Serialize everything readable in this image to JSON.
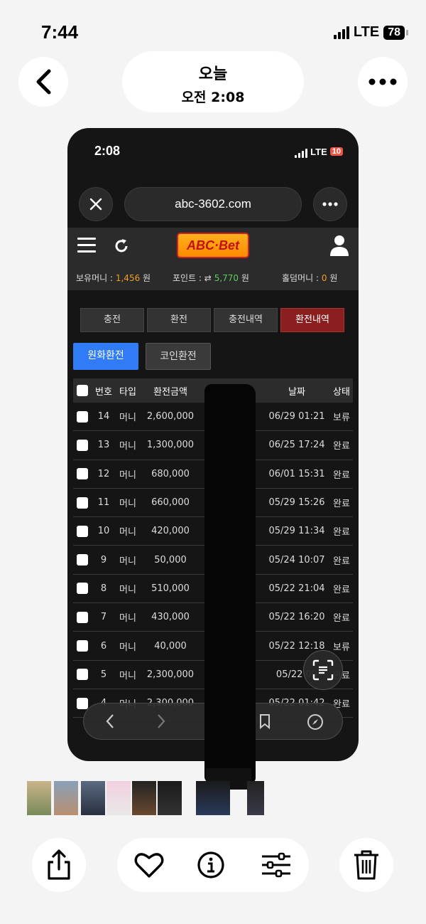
{
  "status_bar": {
    "time": "7:44",
    "network": "LTE",
    "battery": "78"
  },
  "header": {
    "date_label": "오늘",
    "time_label": "오전 2:08"
  },
  "phone": {
    "status": {
      "time": "2:08",
      "network": "LTE",
      "battery": "10"
    },
    "url": "abc-3602.com",
    "logo_text": "ABC·Bet",
    "balances": {
      "money_label": "보유머니 :",
      "money_value": "1,456",
      "money_unit": "원",
      "point_label": "포인트 : ⇄",
      "point_value": "5,770",
      "point_unit": "원",
      "holdem_label": "홀덤머니 :",
      "holdem_value": "0",
      "holdem_unit": "원"
    },
    "tabs": [
      "충전",
      "환전",
      "충전내역",
      "환전내역"
    ],
    "subtabs": [
      "원화환전",
      "코인환전"
    ],
    "table": {
      "headers": [
        "번호",
        "타입",
        "환전금액",
        "",
        "날짜",
        "상태"
      ],
      "rows": [
        {
          "no": "14",
          "type": "머니",
          "amount": "2,600,000",
          "date": "06/29 01:21",
          "status": "보류"
        },
        {
          "no": "13",
          "type": "머니",
          "amount": "1,300,000",
          "date": "06/25 17:24",
          "status": "완료"
        },
        {
          "no": "12",
          "type": "머니",
          "amount": "680,000",
          "date": "06/01 15:31",
          "status": "완료"
        },
        {
          "no": "11",
          "type": "머니",
          "amount": "660,000",
          "date": "05/29 15:26",
          "status": "완료"
        },
        {
          "no": "10",
          "type": "머니",
          "amount": "420,000",
          "date": "05/29 11:34",
          "status": "완료"
        },
        {
          "no": "9",
          "type": "머니",
          "amount": "50,000",
          "date": "05/24 10:07",
          "status": "완료"
        },
        {
          "no": "8",
          "type": "머니",
          "amount": "510,000",
          "date": "05/22 21:04",
          "status": "완료"
        },
        {
          "no": "7",
          "type": "머니",
          "amount": "430,000",
          "date": "05/22 16:20",
          "status": "완료"
        },
        {
          "no": "6",
          "type": "머니",
          "amount": "40,000",
          "date": "05/22 12:18",
          "status": "보류"
        },
        {
          "no": "5",
          "type": "머니",
          "amount": "2,300,000",
          "date": "05/22 09",
          "status": "완료"
        },
        {
          "no": "4",
          "type": "머니",
          "amount": "2,300,000",
          "date": "05/22 01:42",
          "status": "완료"
        }
      ]
    }
  },
  "colors": {
    "accent_red": "#8b1f1f",
    "accent_blue": "#2f7cf6",
    "money_orange": "#f0a020",
    "point_green": "#5ccf5c"
  }
}
